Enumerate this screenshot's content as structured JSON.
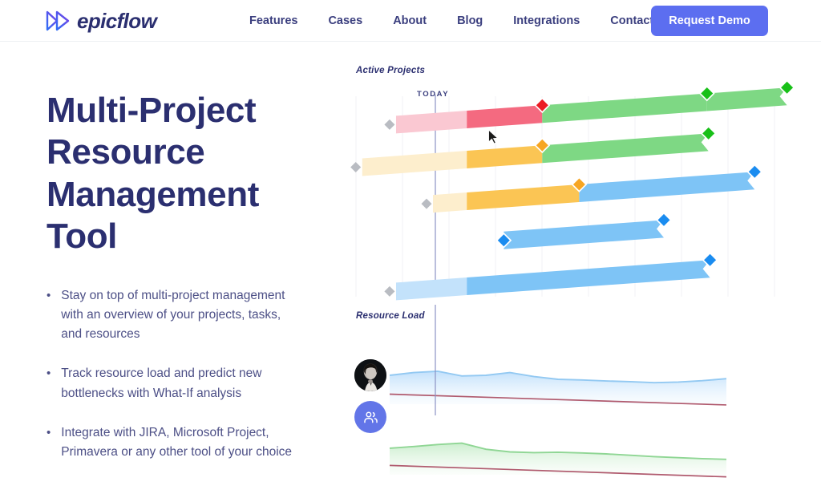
{
  "header": {
    "logo": {
      "text": "epicflow",
      "icon": "double-chevron-icon",
      "gradient_from": "#2f6df6",
      "gradient_to": "#7b3fe4"
    },
    "nav": [
      {
        "label": "Features"
      },
      {
        "label": "Cases"
      },
      {
        "label": "About"
      },
      {
        "label": "Blog"
      },
      {
        "label": "Integrations"
      },
      {
        "label": "Contact us"
      }
    ],
    "cta": {
      "label": "Request Demo",
      "bg": "#5c6ef0",
      "color": "#ffffff"
    }
  },
  "hero": {
    "title_lines": [
      "Multi-Project",
      "Resource",
      "Management",
      "Tool"
    ],
    "title_color": "#2b2f70",
    "bullets": [
      "Stay on top of multi-project management with an overview of your projects, tasks, and resources",
      "Track resource load and predict new bottlenecks with What-If analysis",
      "Integrate with JIRA, Microsoft Project, Primavera or any other tool of your choice"
    ],
    "bullet_marker": "•"
  },
  "visual": {
    "gantt_label": "Active Projects",
    "today_label": "TODAY",
    "load_label": "Resource Load",
    "avatar_photo_name": "resource-avatar",
    "avatar_group_name": "resource-group-icon",
    "colors": {
      "bar_red_light": "#fac8d2",
      "bar_red": "#f46a80",
      "bar_amber_light": "#fdeecd",
      "bar_amber": "#fbc554",
      "bar_green": "#7ed884",
      "bar_blue_light": "#c3e2fb",
      "bar_blue": "#7ec4f6",
      "diamond_gray": "#b9bcc2",
      "diamond_red": "#ec1c24",
      "diamond_amber": "#f7a623",
      "diamond_green": "#18c018",
      "diamond_blue": "#1a8cf0",
      "today_line": "#8c93c4",
      "grid": "#f1f2f5",
      "load_blue_stroke": "#93c9f2",
      "load_green_stroke": "#8fd694",
      "capacity_line": "#b05a6e"
    }
  },
  "chart_data": [
    {
      "type": "bar",
      "title": "Active Projects",
      "subtype": "gantt",
      "today_x": 144,
      "xlim": [
        0,
        560
      ],
      "grid": true,
      "rows": [
        {
          "row": 1,
          "y": 88,
          "start_diamond": "gray",
          "segments": [
            {
              "color": "bar_red_light",
              "x0": 52,
              "x1": 144
            },
            {
              "color": "bar_red",
              "x0": 144,
              "x1": 242
            },
            {
              "color": "bar_green",
              "x0": 242,
              "x1": 456
            },
            {
              "color": "bar_green",
              "x0": 456,
              "x1": 560
            }
          ],
          "milestones": [
            {
              "x": 242,
              "color": "diamond_red"
            },
            {
              "x": 456,
              "color": "diamond_green"
            },
            {
              "x": 560,
              "color": "diamond_green"
            }
          ],
          "cursor_at": 243
        },
        {
          "row": 2,
          "y": 138,
          "start_diamond": "gray",
          "segments": [
            {
              "color": "bar_amber_light",
              "x0": 8,
              "x1": 144
            },
            {
              "color": "bar_amber",
              "x0": 144,
              "x1": 242
            },
            {
              "color": "bar_green",
              "x0": 242,
              "x1": 458
            }
          ],
          "milestones": [
            {
              "x": 242,
              "color": "diamond_amber"
            },
            {
              "x": 458,
              "color": "diamond_green"
            }
          ]
        },
        {
          "row": 3,
          "y": 190,
          "start_diamond": "gray",
          "segments": [
            {
              "color": "bar_amber_light",
              "x0": 100,
              "x1": 144
            },
            {
              "color": "bar_amber",
              "x0": 144,
              "x1": 290
            },
            {
              "color": "bar_blue",
              "x0": 290,
              "x1": 518
            }
          ],
          "milestones": [
            {
              "x": 290,
              "color": "diamond_amber"
            },
            {
              "x": 518,
              "color": "diamond_blue"
            }
          ]
        },
        {
          "row": 4,
          "y": 242,
          "start_diamond": "none",
          "segments": [
            {
              "color": "bar_blue",
              "x0": 192,
              "x1": 400
            }
          ],
          "milestones": [
            {
              "x": 192,
              "color": "diamond_blue"
            },
            {
              "x": 400,
              "color": "diamond_blue"
            }
          ]
        },
        {
          "row": 5,
          "y": 296,
          "start_diamond": "gray",
          "segments": [
            {
              "color": "bar_blue_light",
              "x0": 52,
              "x1": 144
            },
            {
              "color": "bar_blue",
              "x0": 144,
              "x1": 460
            }
          ],
          "milestones": [
            {
              "x": 460,
              "color": "diamond_blue"
            }
          ]
        }
      ]
    },
    {
      "type": "area",
      "title": "Resource Load",
      "xlabel": "",
      "ylabel": "",
      "grid": false,
      "series": [
        {
          "name": "individual-load",
          "color": "#93c9f2",
          "x": [
            0,
            30,
            60,
            90,
            120,
            150,
            180,
            210,
            240,
            270,
            300,
            330,
            360,
            390,
            420
          ],
          "values": [
            62,
            70,
            74,
            60,
            62,
            70,
            58,
            50,
            48,
            45,
            43,
            40,
            42,
            46,
            52
          ]
        },
        {
          "name": "individual-capacity",
          "color": "#b05a6e",
          "type": "line",
          "x": [
            0,
            420
          ],
          "values": [
            44,
            12
          ]
        },
        {
          "name": "team-load",
          "color": "#8fd694",
          "x": [
            0,
            30,
            60,
            90,
            120,
            150,
            180,
            210,
            240,
            270,
            300,
            330,
            360,
            390,
            420
          ],
          "values": [
            55,
            60,
            66,
            70,
            52,
            44,
            42,
            43,
            41,
            38,
            34,
            30,
            27,
            24,
            22
          ]
        },
        {
          "name": "team-capacity",
          "color": "#b05a6e",
          "type": "line",
          "x": [
            0,
            420
          ],
          "values": [
            42,
            8
          ]
        }
      ]
    }
  ]
}
